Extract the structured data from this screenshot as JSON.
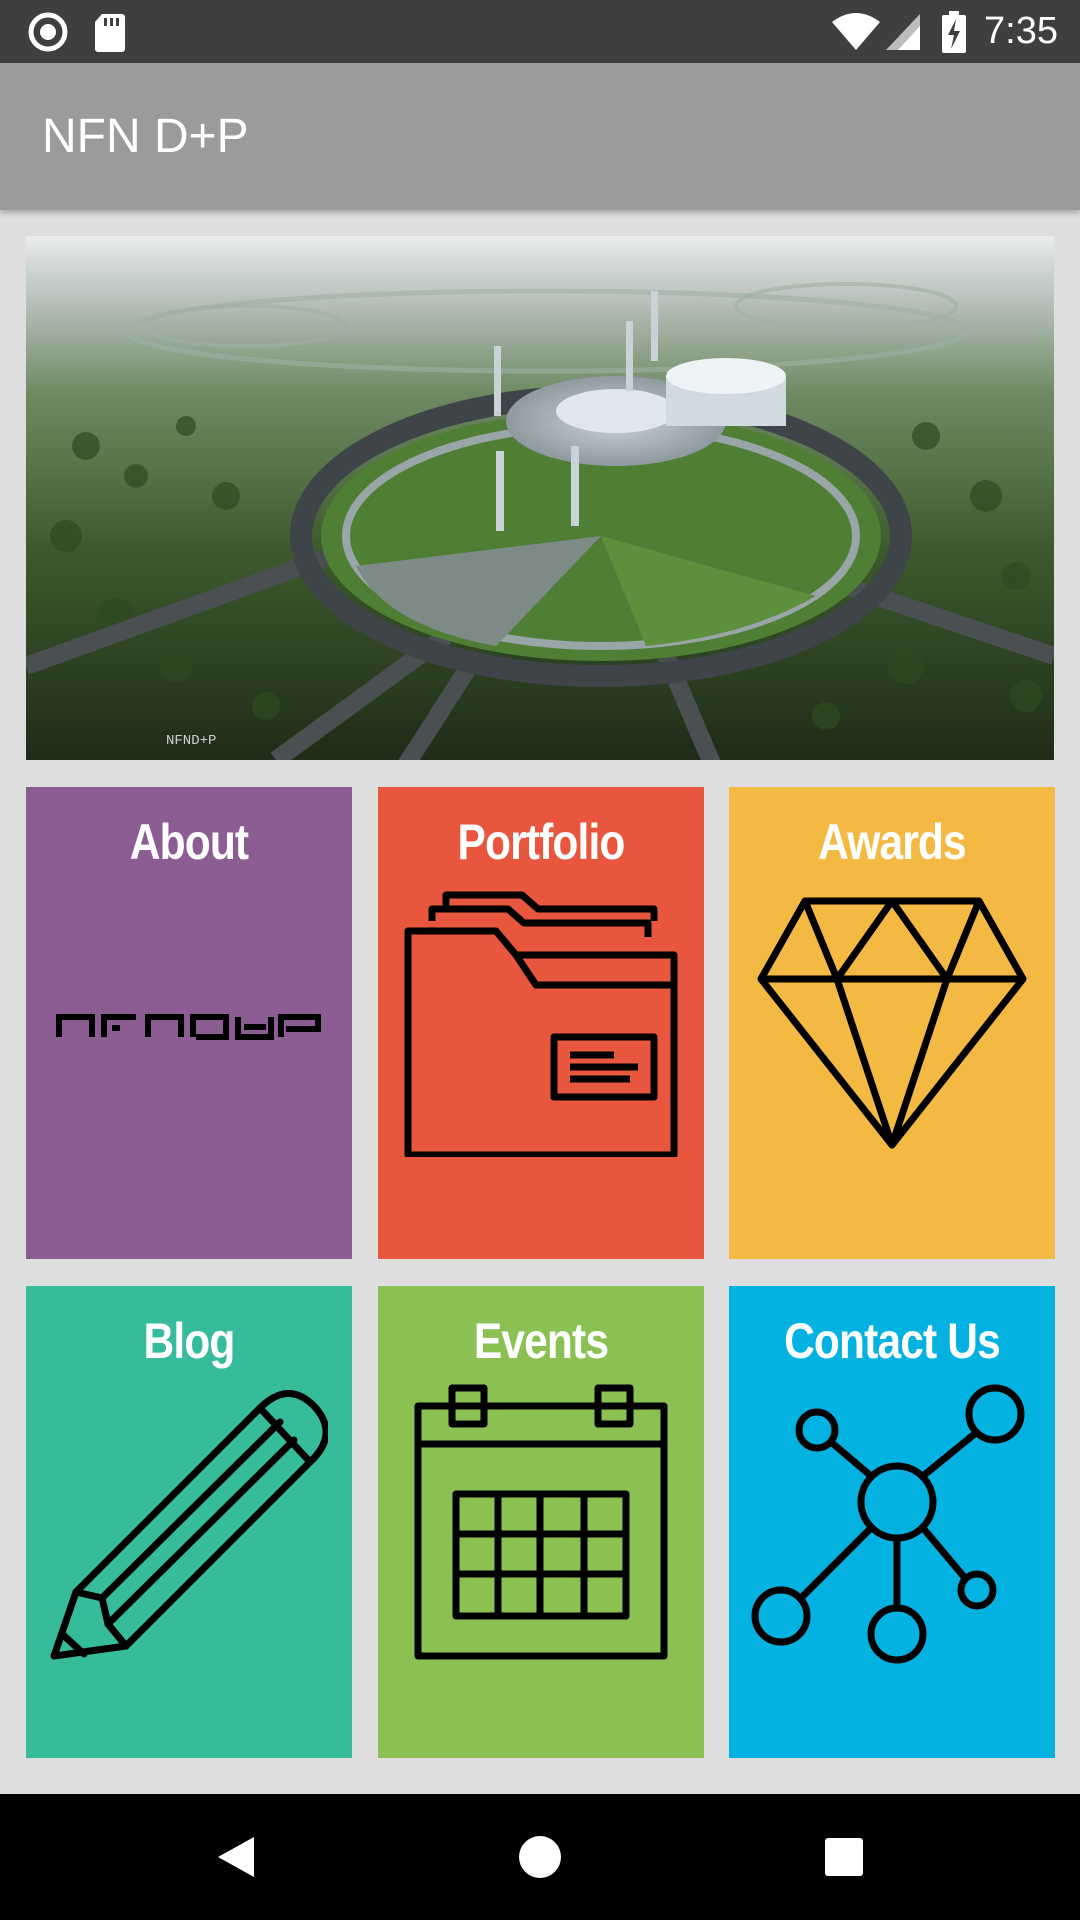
{
  "status_bar": {
    "time": "7:35",
    "left_icons": [
      "record-icon",
      "sd-card-icon"
    ],
    "right_icons": [
      "wifi-icon",
      "signal-icon",
      "battery-charging-icon"
    ]
  },
  "app_bar": {
    "title": "NFN D+P"
  },
  "hero": {
    "description": "aerial-architecture-render",
    "watermark": "NFND+P"
  },
  "tiles": [
    {
      "label": "About",
      "color": "#8c5d93",
      "icon": "nfndp-logo"
    },
    {
      "label": "Portfolio",
      "color": "#e8573d",
      "icon": "folder-icon"
    },
    {
      "label": "Awards",
      "color": "#f4b942",
      "icon": "diamond-icon"
    },
    {
      "label": "Blog",
      "color": "#36bc9b",
      "icon": "pencil-icon"
    },
    {
      "label": "Events",
      "color": "#8bc053",
      "icon": "calendar-icon"
    },
    {
      "label": "Contact Us",
      "color": "#03b2e0",
      "icon": "network-icon"
    }
  ],
  "nav_bar": {
    "buttons": [
      "back-icon",
      "home-icon",
      "recents-icon"
    ]
  }
}
